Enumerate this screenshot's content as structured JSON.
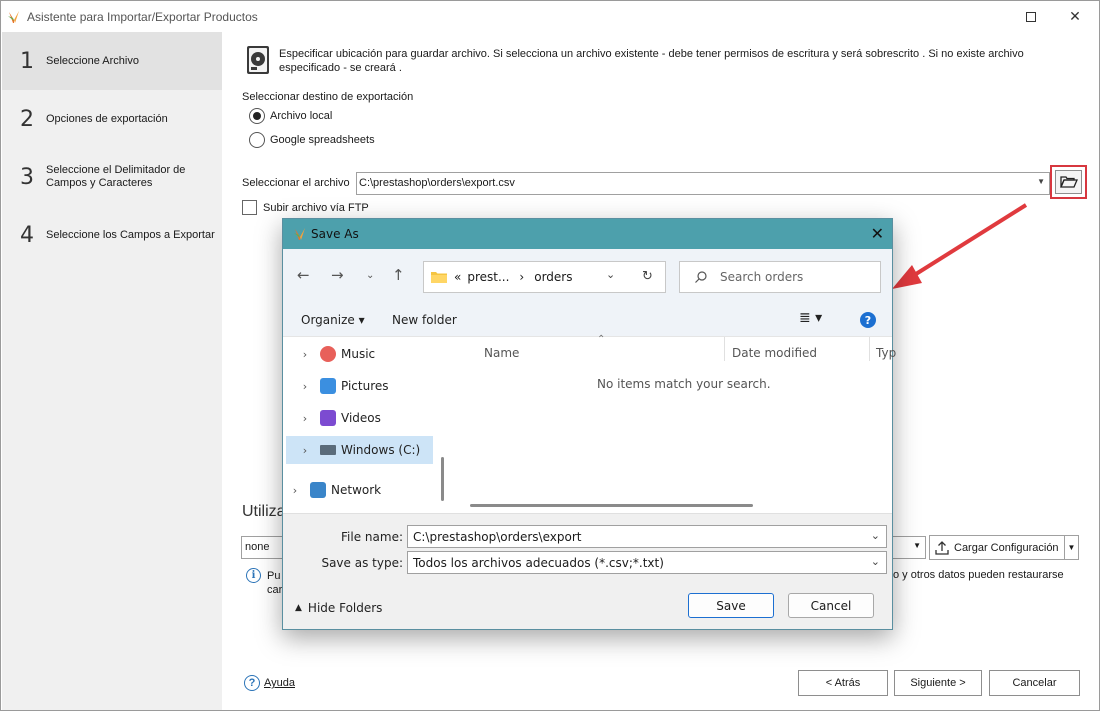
{
  "window": {
    "title": "Asistente para Importar/Exportar Productos"
  },
  "sidebar": {
    "steps": [
      {
        "num": "1",
        "label": "Seleccione Archivo"
      },
      {
        "num": "2",
        "label": "Opciones de exportación"
      },
      {
        "num": "3",
        "label": "Seleccione el Delimitador de Campos y Caracteres"
      },
      {
        "num": "4",
        "label": "Seleccione los Campos a Exportar"
      }
    ]
  },
  "main": {
    "description": "Especificar ubicación para guardar archivo. Si selecciona un archivo existente - debe tener permisos de escritura y será sobrescrito . Si no existe archivo especificado - se creará .",
    "destination_label": "Seleccionar destino de exportación",
    "radio_local": "Archivo local",
    "radio_google": "Google spreadsheets",
    "file_label": "Seleccionar el archivo",
    "file_value": "C:\\prestashop\\orders\\export.csv",
    "ftp_label": "Subir archivo vía FTP",
    "util_title_partial": "Utiliza",
    "config_value": "none",
    "load_config_label": "Cargar Configuración",
    "note_left": "Pu",
    "note_left2": "car",
    "note_right": "o y otros datos pueden restaurarse",
    "help_label": "Ayuda",
    "back_label": "< Atrás",
    "next_label": "Siguiente >",
    "cancel_label": "Cancelar"
  },
  "save_dialog": {
    "title": "Save As",
    "breadcrumb_prefix": "«",
    "breadcrumb_1": "prest...",
    "breadcrumb_sep": "›",
    "breadcrumb_2": "orders",
    "search_placeholder": "Search orders",
    "organize_label": "Organize",
    "new_folder_label": "New folder",
    "help_glyph": "?",
    "nav_items": [
      {
        "label": "Music"
      },
      {
        "label": "Pictures"
      },
      {
        "label": "Videos"
      },
      {
        "label": "Windows (C:)"
      },
      {
        "label": "Network"
      }
    ],
    "col_name": "Name",
    "col_date": "Date modified",
    "col_type": "Typ",
    "empty_message": "No items match your search.",
    "file_name_label": "File name:",
    "file_name_value": "C:\\prestashop\\orders\\export",
    "save_type_label": "Save as type:",
    "save_type_value": "Todos los archivos adecuados (*.csv;*.txt)",
    "hide_folders_label": "Hide Folders",
    "save_label": "Save",
    "cancel_label": "Cancel"
  },
  "colors": {
    "dialog_title_bg": "#4da0ac",
    "highlight_red": "#d7373f",
    "arrow_red": "#e03a3e",
    "selected_nav": "#cde4f7"
  }
}
